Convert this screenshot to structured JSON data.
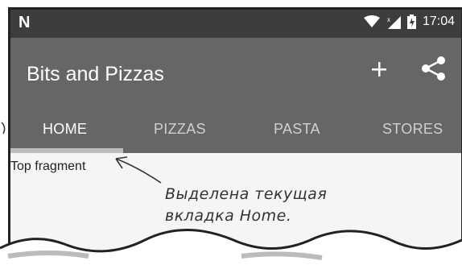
{
  "status_bar": {
    "notification_letter": "N",
    "time": "17:04"
  },
  "app_bar": {
    "title": "Bits and Pizzas",
    "actions": [
      "add-icon",
      "share-icon"
    ]
  },
  "tabs": [
    {
      "label": "HOME",
      "active": true
    },
    {
      "label": "PIZZAS",
      "active": false
    },
    {
      "label": "PASTA",
      "active": false
    },
    {
      "label": "STORES",
      "active": false
    }
  ],
  "content": {
    "fragment_text": "Top fragment"
  },
  "annotation": {
    "line1": "Выделена текущая",
    "line2": "вкладка Home."
  },
  "colors": {
    "app_bar": "#666666",
    "status_bar": "#3d3d3d",
    "tab_indicator": "#bdbdbd"
  }
}
